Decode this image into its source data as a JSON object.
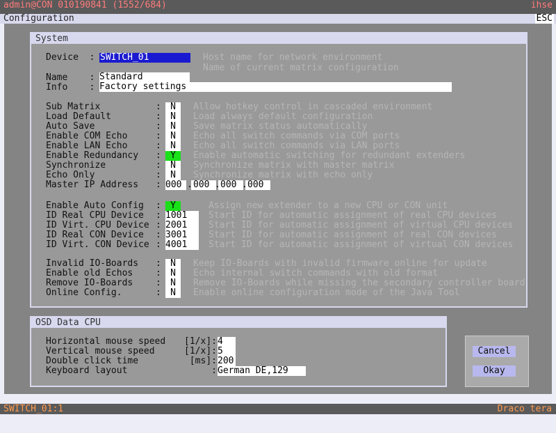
{
  "topbar": {
    "left": "admin@CON 010190841 (1552/684)",
    "right": "ihse"
  },
  "cfgbar": {
    "title": "Configuration",
    "esc": "ESC"
  },
  "system": {
    "title": "System",
    "device_label": "Device  :",
    "device_value": "SWITCH_01",
    "device_hint": "Host name for network environment",
    "name_hint": "Name of current matrix configuration",
    "name_label": "Name    :",
    "name_value": "Standard",
    "info_label": "Info    :",
    "info_value": "Factory settings",
    "rows1": [
      {
        "label": "Sub Matrix",
        "value": "N",
        "hint": "Allow hotkey control in cascaded environment"
      },
      {
        "label": "Load Default",
        "value": "N",
        "hint": "Load always default configuration"
      },
      {
        "label": "Auto Save",
        "value": "N",
        "hint": "Save matrix status automatically"
      },
      {
        "label": "Enable COM Echo",
        "value": "N",
        "hint": "Echo all switch commands via COM ports"
      },
      {
        "label": "Enable LAN Echo",
        "value": "N",
        "hint": "Echo all switch commands via LAN ports"
      },
      {
        "label": "Enable Redundancy",
        "value": "Y",
        "hint": "Enable automatic switching for redundant extenders"
      },
      {
        "label": "Synchronize",
        "value": "N",
        "hint": "Synchronize matrix with master matrix"
      },
      {
        "label": "Echo Only",
        "value": "N",
        "hint": "Synchronize matrix with echo only"
      }
    ],
    "master_ip_label": "Master IP Address",
    "master_ip": [
      "000",
      "000",
      "000",
      "000"
    ],
    "auto_config": {
      "label": "Enable Auto Config",
      "value": "Y",
      "hint": "Assign new extender to a new CPU or CON unit"
    },
    "rows2": [
      {
        "label": "ID Real CPU Device",
        "value": "1001",
        "hint": "Start ID for automatic assignment of real CPU devices"
      },
      {
        "label": "ID Virt. CPU Device",
        "value": "2001",
        "hint": "Start ID for automatic assignment of virtual CPU devices"
      },
      {
        "label": "ID Real CON Device",
        "value": "3001",
        "hint": "Start ID for automatic assignment of real CON devices"
      },
      {
        "label": "ID Virt. CON Device",
        "value": "4001",
        "hint": "Start ID for automatic assignment of virtual CON devices"
      }
    ],
    "rows3": [
      {
        "label": "Invalid IO-Boards",
        "value": "N",
        "hint": "Keep IO-Boards with invalid firmware online for update"
      },
      {
        "label": "Enable old Echos",
        "value": "N",
        "hint": "Echo internal switch commands with old format"
      },
      {
        "label": "Remove IO-Boards",
        "value": "N",
        "hint": "Remove IO-Boards while missing the secondary controller board"
      },
      {
        "label": "Online Config.",
        "value": "N",
        "hint": "Enable online configuration mode of the Java Tool"
      }
    ]
  },
  "osd": {
    "title": "OSD Data CPU",
    "rows": [
      {
        "label": "Horizontal mouse speed",
        "unit": "[1/x]:",
        "value": "4"
      },
      {
        "label": "Vertical mouse speed",
        "unit": "[1/x]:",
        "value": "5"
      },
      {
        "label": "Double click time",
        "unit": "[ms]:",
        "value": "200"
      },
      {
        "label": "Keyboard layout",
        "unit": ":",
        "value": "German DE,129"
      }
    ]
  },
  "buttons": {
    "cancel": "Cancel",
    "okay": "Okay"
  },
  "bottombar": {
    "left": "SWITCH_01:1",
    "right": "Draco tera"
  },
  "colors": {
    "accent": "#1a1ad0",
    "active": "#19e019",
    "status_text": "#ff9a4d"
  }
}
